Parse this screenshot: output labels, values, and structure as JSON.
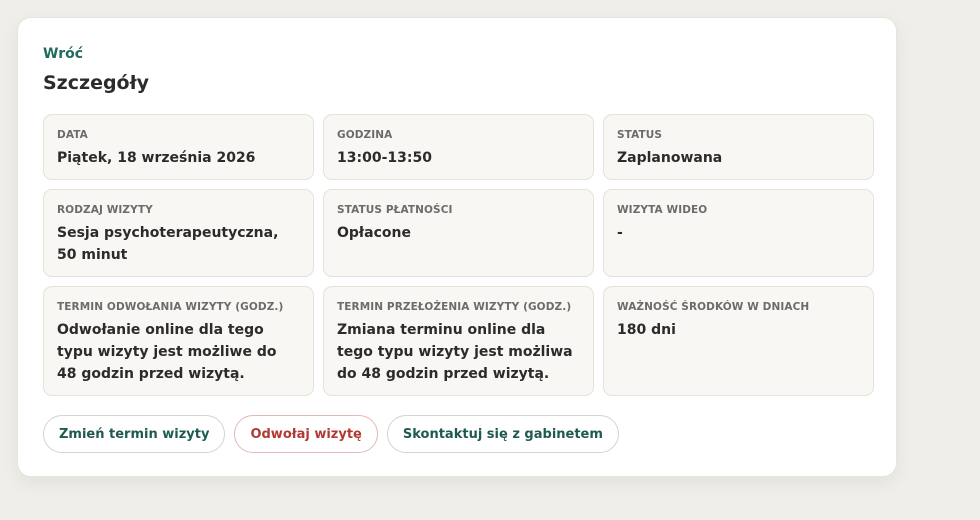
{
  "header": {
    "back_label": "Wróć",
    "title": "Szczegóły"
  },
  "details": [
    {
      "label": "DATA",
      "value": "Piątek, 18 września 2026"
    },
    {
      "label": "GODZINA",
      "value": "13:00-13:50"
    },
    {
      "label": "STATUS",
      "value": "Zaplanowana"
    },
    {
      "label": "RODZAJ WIZYTY",
      "value": "Sesja psychoterapeutyczna, 50 minut"
    },
    {
      "label": "STATUS PŁATNOŚCI",
      "value": "Opłacone"
    },
    {
      "label": "WIZYTA WIDEO",
      "value": "-"
    },
    {
      "label": "TERMIN ODWOŁANIA WIZYTY (GODZ.)",
      "value": "Odwołanie online dla tego typu wizyty jest możliwe do 48 godzin przed wizytą."
    },
    {
      "label": "TERMIN PRZEŁOŻENIA WIZYTY (GODZ.)",
      "value": "Zmiana terminu online dla tego typu wizyty jest możliwa do 48 godzin przed wizytą."
    },
    {
      "label": "WAŻNOŚĆ ŚRODKÓW W DNIACH",
      "value": "180 dni"
    }
  ],
  "actions": {
    "reschedule_label": "Zmień termin wizyty",
    "cancel_label": "Odwołaj wizytę",
    "contact_label": "Skontaktuj się z gabinetem"
  },
  "colors": {
    "accent": "#1f6b5e",
    "danger": "#b23a34",
    "tile_background": "#f8f7f3",
    "page_background": "#f0eee9"
  }
}
